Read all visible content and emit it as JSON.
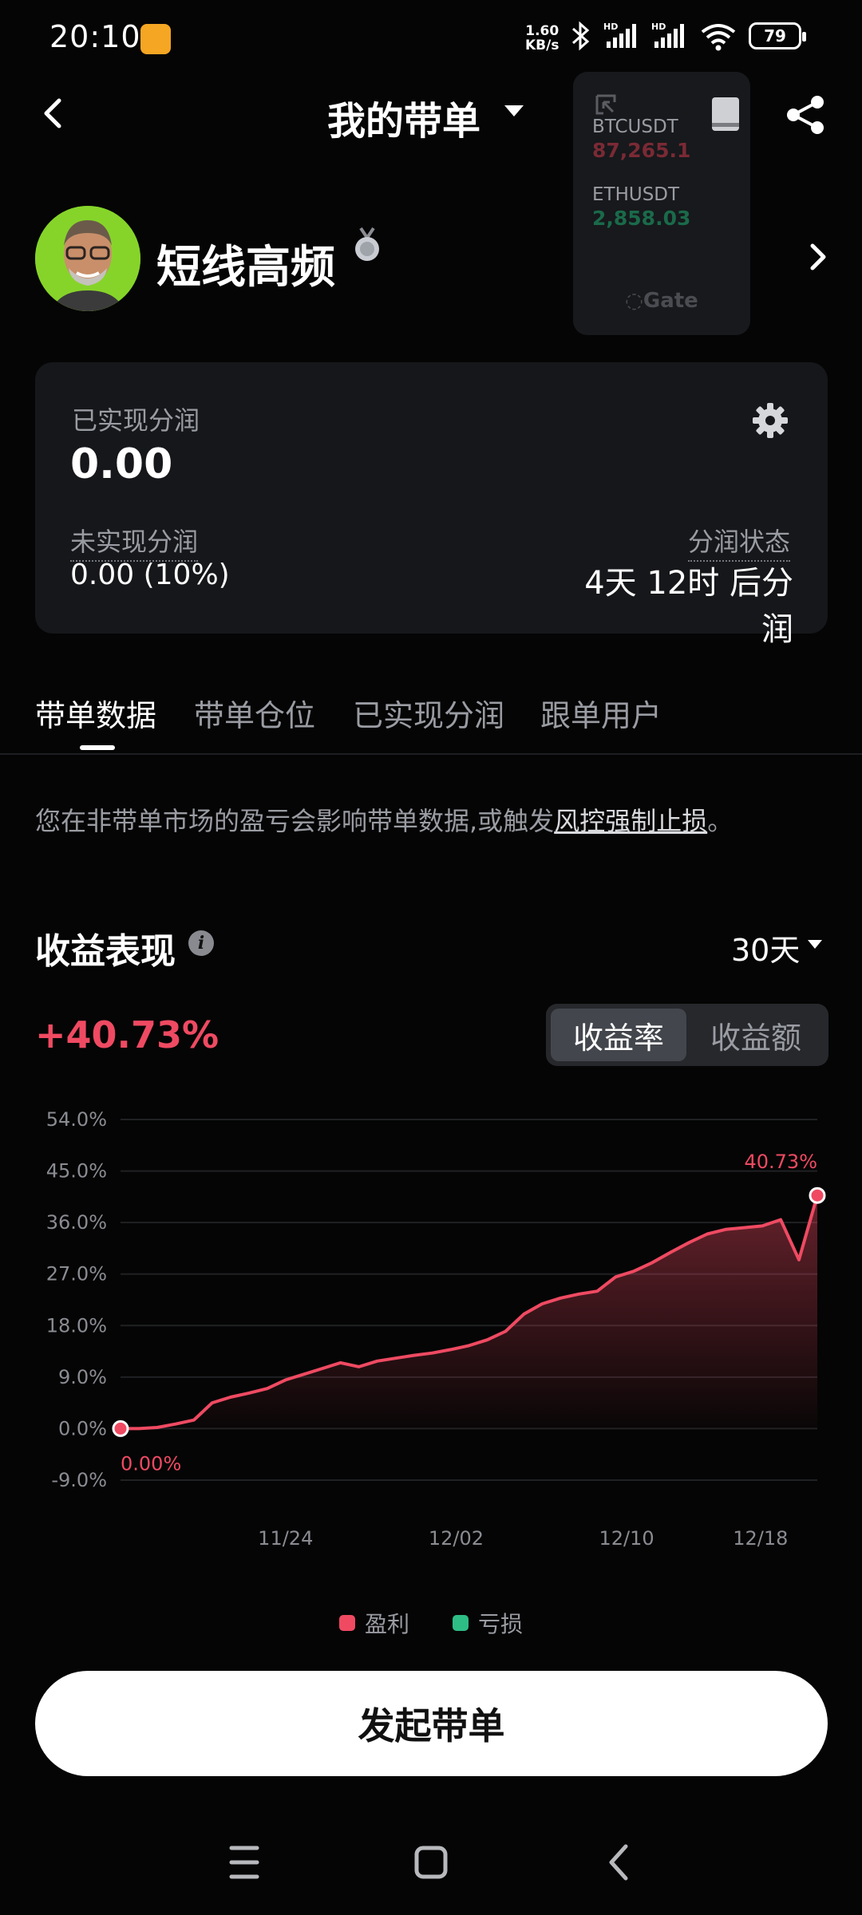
{
  "status_bar": {
    "time": "20:10",
    "net_speed": "1.60",
    "net_unit": "KB/s",
    "battery": "79"
  },
  "header": {
    "title": "我的带单"
  },
  "ticker": {
    "items": [
      {
        "symbol": "BTCUSDT",
        "price": "87,265.1"
      },
      {
        "symbol": "ETHUSDT",
        "price": "2,858.03"
      }
    ],
    "logo": "Gate"
  },
  "profile": {
    "name": "短线高频"
  },
  "summary": {
    "realized_label": "已实现分润",
    "realized_value": "0.00",
    "unrealized_label": "未实现分润",
    "unrealized_value": "0.00 (10%)",
    "status_label": "分润状态",
    "status_value": "4天 12时 后分润"
  },
  "tabs": [
    "带单数据",
    "带单仓位",
    "已实现分润",
    "跟单用户"
  ],
  "notice": {
    "text": "您在非带单市场的盈亏会影响带单数据,或触发",
    "link": "风控强制止损",
    "end": "。"
  },
  "performance": {
    "title": "收益表现",
    "period": "30天",
    "value": "+40.73%",
    "toggle_on": "收益率",
    "toggle_off": "收益额"
  },
  "chart_data": {
    "type": "area",
    "y_ticks": [
      "54.0%",
      "45.0%",
      "36.0%",
      "27.0%",
      "18.0%",
      "9.0%",
      "0.0%",
      "-9.0%"
    ],
    "ylim": [
      -9,
      54
    ],
    "x_ticks": [
      "11/24",
      "12/02",
      "12/10",
      "12/18"
    ],
    "series": [
      {
        "name": "盈利",
        "values": [
          0.0,
          0.0,
          0.2,
          0.8,
          1.5,
          4.5,
          5.5,
          6.2,
          7.0,
          8.5,
          9.5,
          10.5,
          11.5,
          10.8,
          11.8,
          12.3,
          12.8,
          13.2,
          13.8,
          14.5,
          15.5,
          17.0,
          20.0,
          21.8,
          22.8,
          23.5,
          24.0,
          26.5,
          27.5,
          29.0,
          30.8,
          32.5,
          34.0,
          34.8,
          35.1,
          35.4,
          36.5,
          29.5,
          40.73
        ]
      }
    ],
    "start_label": "0.00%",
    "end_label": "40.73%",
    "legend": [
      {
        "label": "盈利",
        "color": "#ef4a62"
      },
      {
        "label": "亏损",
        "color": "#2ebd85"
      }
    ],
    "grid": true
  },
  "cta": {
    "label": "发起带单"
  }
}
